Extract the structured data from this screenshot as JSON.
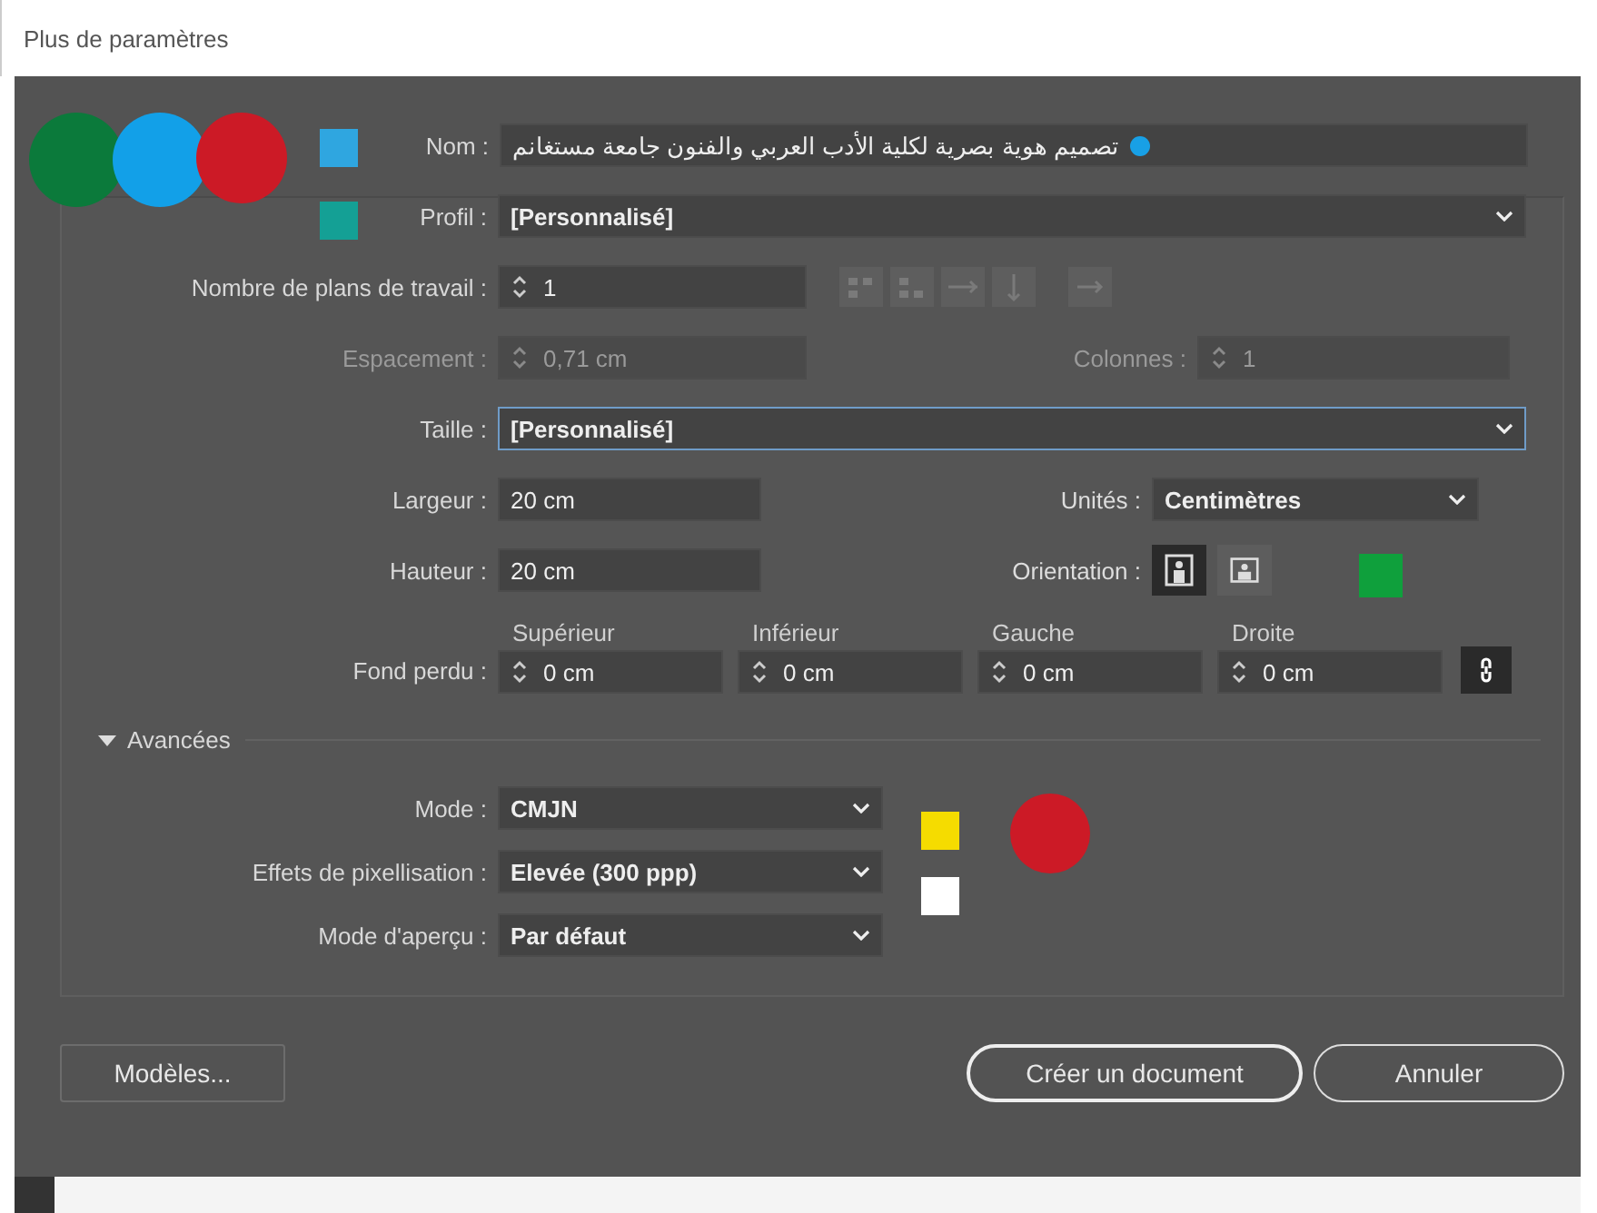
{
  "window": {
    "title": "Plus de paramètres"
  },
  "name": {
    "label": "Nom :",
    "value": "تصميم هوية بصرية لكلية الأدب العربي والفنون  جامعة مستغانم"
  },
  "profile": {
    "label": "Profil :",
    "value": "[Personnalisé]"
  },
  "artboards": {
    "label": "Nombre de plans de travail :",
    "value": "1",
    "disabled": false
  },
  "spacing": {
    "label": "Espacement :",
    "value": "0,71 cm",
    "disabled": true
  },
  "columns": {
    "label": "Colonnes :",
    "value": "1",
    "disabled": true
  },
  "size": {
    "label": "Taille :",
    "value": "[Personnalisé]",
    "focused": true
  },
  "width": {
    "label": "Largeur :",
    "value": "20 cm"
  },
  "units": {
    "label": "Unités :",
    "value": "Centimètres"
  },
  "height": {
    "label": "Hauteur :",
    "value": "20 cm"
  },
  "orientation": {
    "label": "Orientation :",
    "options": [
      {
        "kind": "portrait",
        "selected": true
      },
      {
        "kind": "landscape",
        "selected": false
      }
    ]
  },
  "bleed": {
    "label": "Fond perdu :",
    "fields": [
      {
        "caption": "Supérieur",
        "value": "0 cm"
      },
      {
        "caption": "Inférieur",
        "value": "0 cm"
      },
      {
        "caption": "Gauche",
        "value": "0 cm"
      },
      {
        "caption": "Droite",
        "value": "0 cm"
      }
    ]
  },
  "advanced": {
    "label": "Avancées",
    "expanded": true,
    "rows": [
      {
        "label": "Mode :",
        "value": "CMJN"
      },
      {
        "label": "Effets de pixellisation :",
        "value": "Elevée (300 ppp)"
      },
      {
        "label": "Mode d'aperçu :",
        "value": "Par défaut"
      }
    ]
  },
  "buttons": [
    {
      "label": "Modèles...",
      "kind": "plain"
    },
    {
      "label": "Créer un document",
      "kind": "primary"
    },
    {
      "label": "Annuler",
      "kind": "secondary"
    }
  ],
  "markers": [
    {
      "kind": "circle",
      "color": "#0b7a3b"
    },
    {
      "kind": "circle",
      "color": "#12a0e8"
    },
    {
      "kind": "circle",
      "color": "#cc1a26"
    },
    {
      "kind": "square",
      "color": "#2fa6e0"
    },
    {
      "kind": "square",
      "color": "#14a095"
    },
    {
      "kind": "square",
      "color": "#0fa03c"
    },
    {
      "kind": "square",
      "color": "#f5dc00"
    },
    {
      "kind": "square",
      "color": "#ffffff"
    },
    {
      "kind": "circle",
      "color": "#cc1a26"
    }
  ]
}
